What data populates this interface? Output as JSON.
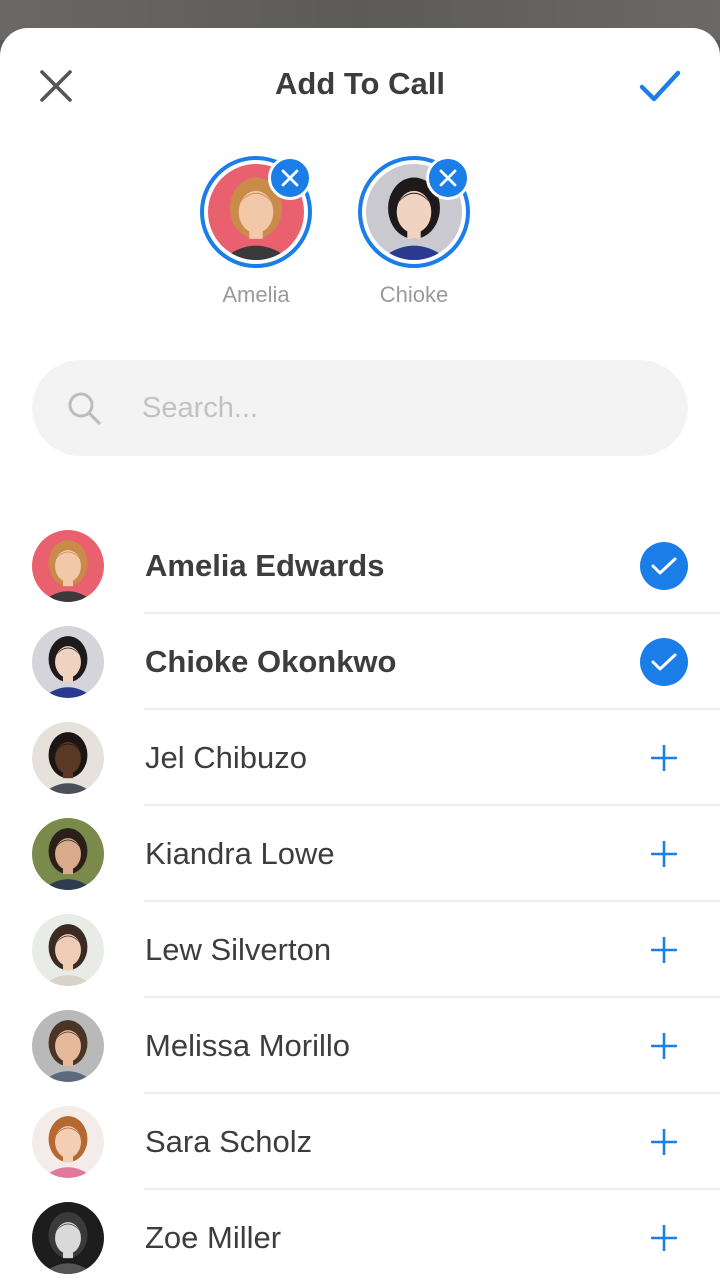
{
  "header": {
    "title": "Add To Call",
    "close_icon": "close-icon",
    "confirm_icon": "checkmark-icon"
  },
  "colors": {
    "accent": "#1a7de8",
    "text": "#3d3d3d",
    "muted": "#9a9a9a",
    "search_bg": "#f3f3f3"
  },
  "selected": [
    {
      "name": "Amelia",
      "palette": {
        "bg": "#e9616f",
        "hair": "#c98b4a",
        "skin": "#f2c9a8",
        "shirt": "#3a3a3a"
      }
    },
    {
      "name": "Chioke",
      "palette": {
        "bg": "#c9c9cf",
        "hair": "#1e1a1c",
        "skin": "#f1d3c1",
        "shirt": "#2b3a8f"
      }
    }
  ],
  "search": {
    "placeholder": "Search..."
  },
  "contacts": [
    {
      "name": "Amelia Edwards",
      "selected": true,
      "palette": {
        "bg": "#e9616f",
        "hair": "#c98b4a",
        "skin": "#f2c9a8",
        "shirt": "#3a3a3a"
      }
    },
    {
      "name": "Chioke Okonkwo",
      "selected": true,
      "palette": {
        "bg": "#d4d4da",
        "hair": "#1e1a1c",
        "skin": "#f1d3c1",
        "shirt": "#2b3a8f"
      }
    },
    {
      "name": "Jel Chibuzo",
      "selected": false,
      "palette": {
        "bg": "#e6e1da",
        "hair": "#1b1613",
        "skin": "#5a3826",
        "shirt": "#4b4f5a"
      }
    },
    {
      "name": "Kiandra Lowe",
      "selected": false,
      "palette": {
        "bg": "#7a8a4a",
        "hair": "#2b2019",
        "skin": "#d9ab8c",
        "shirt": "#2f3b4f"
      }
    },
    {
      "name": "Lew Silverton",
      "selected": false,
      "palette": {
        "bg": "#e8ebe6",
        "hair": "#3a2a22",
        "skin": "#f0cdb6",
        "shirt": "#d8d2c8"
      }
    },
    {
      "name": "Melissa Morillo",
      "selected": false,
      "palette": {
        "bg": "#b9b9b9",
        "hair": "#4a3426",
        "skin": "#e4b99b",
        "shirt": "#5b6a7a"
      }
    },
    {
      "name": "Sara Scholz",
      "selected": false,
      "palette": {
        "bg": "#f3ece8",
        "hair": "#b5682f",
        "skin": "#f3cdb4",
        "shirt": "#e07a9a"
      }
    },
    {
      "name": "Zoe Miller",
      "selected": false,
      "palette": {
        "bg": "#1d1d1d",
        "hair": "#3a3a3a",
        "skin": "#d9d9d9",
        "shirt": "#555555"
      }
    }
  ]
}
